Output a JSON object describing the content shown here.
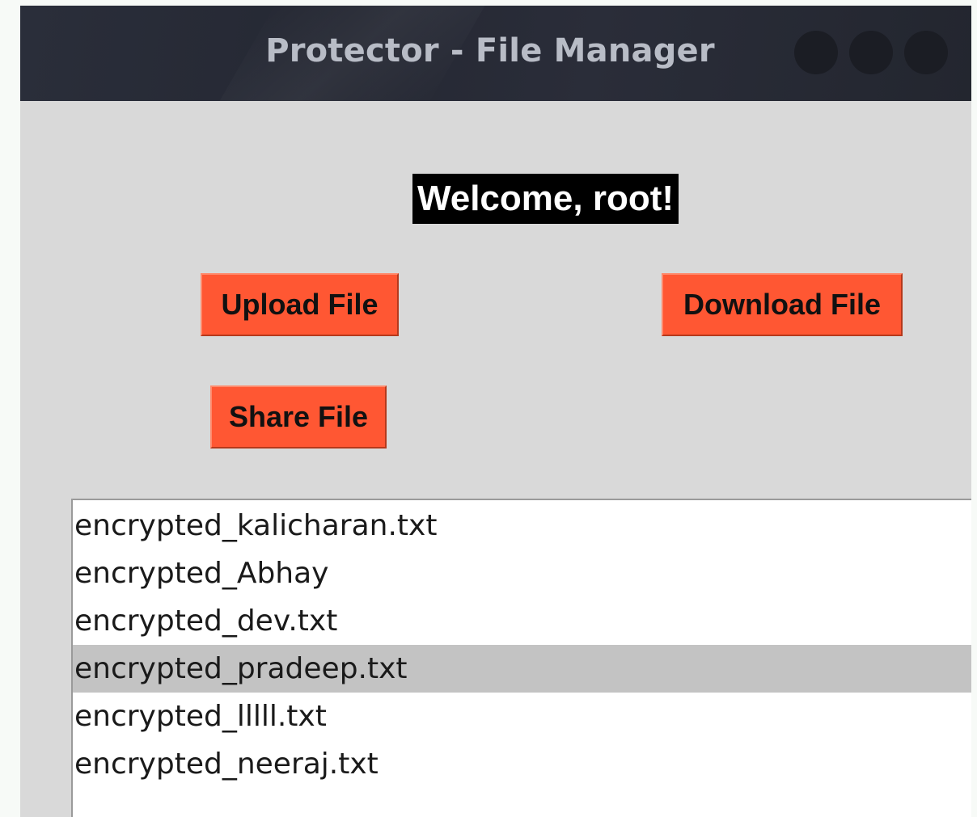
{
  "window": {
    "title": "Protector - File Manager"
  },
  "welcome_text": "Welcome, root!",
  "buttons": {
    "upload": "Upload File",
    "download": "Download File",
    "share": "Share File"
  },
  "files": [
    "encrypted_kalicharan.txt",
    "encrypted_Abhay",
    "encrypted_dev.txt",
    "encrypted_pradeep.txt",
    "encrypted_lllll.txt",
    "encrypted_neeraj.txt"
  ],
  "selected_file": "encrypted_pradeep.txt",
  "colors": {
    "button_bg": "#ff5733",
    "titlebar_bg": "#262933",
    "window_bg": "#d9d9d9",
    "selection_bg": "#c3c3c3"
  }
}
